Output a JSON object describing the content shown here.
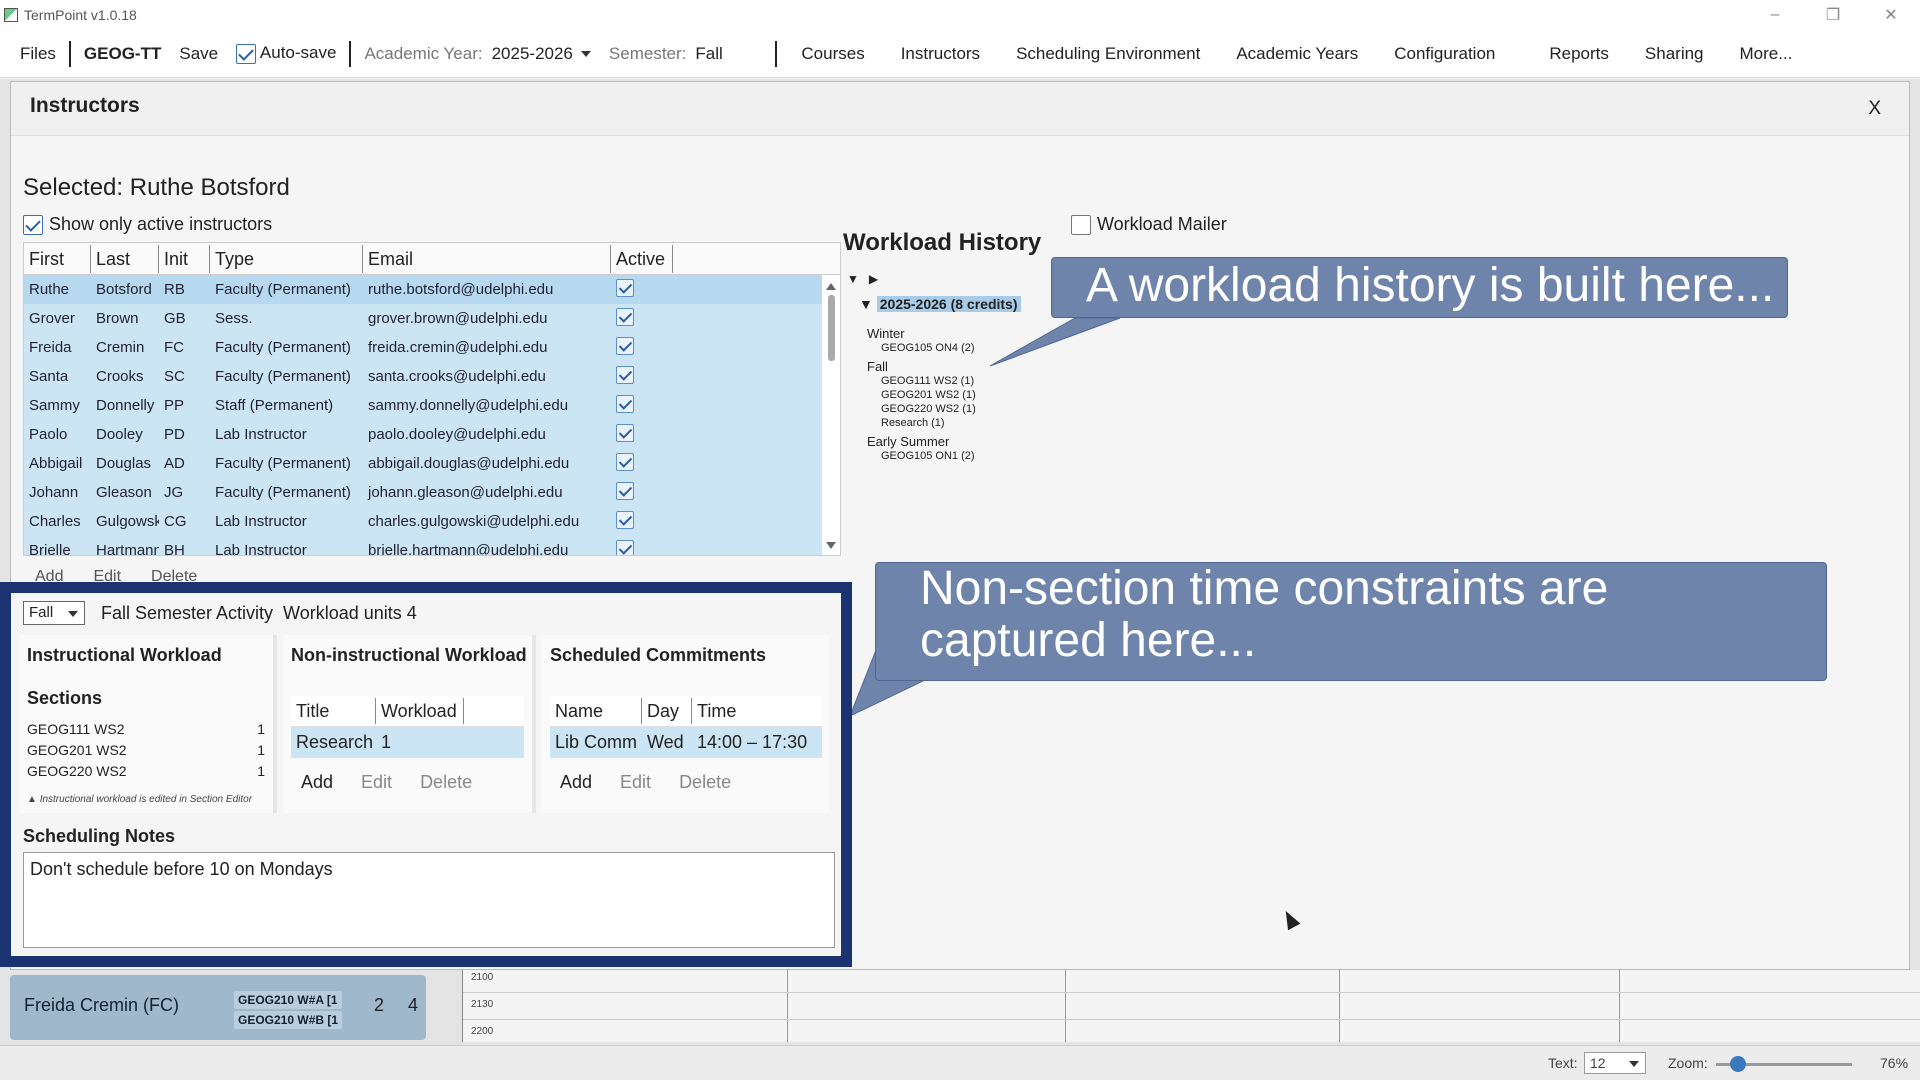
{
  "window": {
    "title": "TermPoint v1.0.18",
    "controls": [
      "–",
      "❐",
      "✕"
    ]
  },
  "menu": {
    "files": "Files",
    "project": "GEOG-TT",
    "save": "Save",
    "autosave": "Auto-save",
    "academic_year_label": "Academic Year:",
    "academic_year_value": "2025-2026",
    "semester_label": "Semester:",
    "semester_value": "Fall",
    "items": [
      "Courses",
      "Instructors",
      "Scheduling Environment",
      "Academic Years",
      "Configuration",
      "Reports",
      "Sharing",
      "More..."
    ]
  },
  "dialog": {
    "title": "Instructors",
    "close": "X",
    "selected_label": "Selected:",
    "selected_name": "Ruthe Botsford",
    "active_only": "Show only active instructors",
    "columns": [
      "First",
      "Last",
      "Init",
      "Type",
      "Email",
      "Active"
    ],
    "rows": [
      [
        "Ruthe",
        "Botsford",
        "RB",
        "Faculty (Permanent)",
        "ruthe.botsford@udelphi.edu"
      ],
      [
        "Grover",
        "Brown",
        "GB",
        "Sess.",
        "grover.brown@udelphi.edu"
      ],
      [
        "Freida",
        "Cremin",
        "FC",
        "Faculty (Permanent)",
        "freida.cremin@udelphi.edu"
      ],
      [
        "Santa",
        "Crooks",
        "SC",
        "Faculty (Permanent)",
        "santa.crooks@udelphi.edu"
      ],
      [
        "Sammy",
        "Donnelly",
        "PP",
        "Staff (Permanent)",
        "sammy.donnelly@udelphi.edu"
      ],
      [
        "Paolo",
        "Dooley",
        "PD",
        "Lab Instructor",
        "paolo.dooley@udelphi.edu"
      ],
      [
        "Abbigail",
        "Douglas",
        "AD",
        "Faculty (Permanent)",
        "abbigail.douglas@udelphi.edu"
      ],
      [
        "Johann",
        "Gleason",
        "JG",
        "Faculty (Permanent)",
        "johann.gleason@udelphi.edu"
      ],
      [
        "Charles",
        "Gulgowski",
        "CG",
        "Lab Instructor",
        "charles.gulgowski@udelphi.edu"
      ],
      [
        "Brielle",
        "Hartmann",
        "BH",
        "Lab Instructor",
        "brielle.hartmann@udelphi.edu"
      ]
    ],
    "table_actions": [
      "Add",
      "Edit",
      "Delete"
    ]
  },
  "workload_history": {
    "title": "Workload History",
    "mailer": "Workload Mailer",
    "year": "2025-2026 (8 credits)",
    "semesters": [
      {
        "name": "Winter",
        "items": [
          "GEOG105 ON4 (2)"
        ]
      },
      {
        "name": "Fall",
        "items": [
          "GEOG111 WS2 (1)",
          "GEOG201 WS2 (1)",
          "GEOG220 WS2 (1)",
          "Research (1)"
        ]
      },
      {
        "name": "Early Summer",
        "items": [
          "GEOG105 ON1 (2)"
        ]
      }
    ]
  },
  "callouts": {
    "history": "A workload history is built here...",
    "constraints": "Non-section time constraints are captured here..."
  },
  "semester_panel": {
    "semester": "Fall",
    "activity": "Fall Semester Activity",
    "workload_units": "Workload units 4",
    "instructional": {
      "title": "Instructional Workload",
      "sections_label": "Sections",
      "sections": [
        {
          "name": "GEOG111 WS2",
          "units": "1"
        },
        {
          "name": "GEOG201 WS2",
          "units": "1"
        },
        {
          "name": "GEOG220 WS2",
          "units": "1"
        }
      ],
      "note": "Instructional workload is edited in Section Editor"
    },
    "non_instructional": {
      "title": "Non-instructional Workload",
      "columns": [
        "Title",
        "Workload"
      ],
      "rows": [
        [
          "Research",
          "1"
        ]
      ],
      "actions": [
        "Add",
        "Edit",
        "Delete"
      ]
    },
    "commitments": {
      "title": "Scheduled Commitments",
      "columns": [
        "Name",
        "Day",
        "Time"
      ],
      "rows": [
        [
          "Lib Comm",
          "Wed",
          "14:00 – 17:30"
        ]
      ],
      "actions": [
        "Add",
        "Edit",
        "Delete"
      ]
    },
    "notes_title": "Scheduling Notes",
    "notes": "Don't schedule before 10 on Mondays"
  },
  "background": {
    "instructor": "Freida Cremin (FC)",
    "chips": [
      "GEOG210 W#A [1",
      "GEOG210 W#B [1"
    ],
    "count1": "2",
    "count2": "4",
    "times": [
      "2100",
      "2130",
      "2200"
    ]
  },
  "status": {
    "text_label": "Text:",
    "text_size": "12",
    "zoom_label": "Zoom:",
    "zoom_value": "76%"
  }
}
